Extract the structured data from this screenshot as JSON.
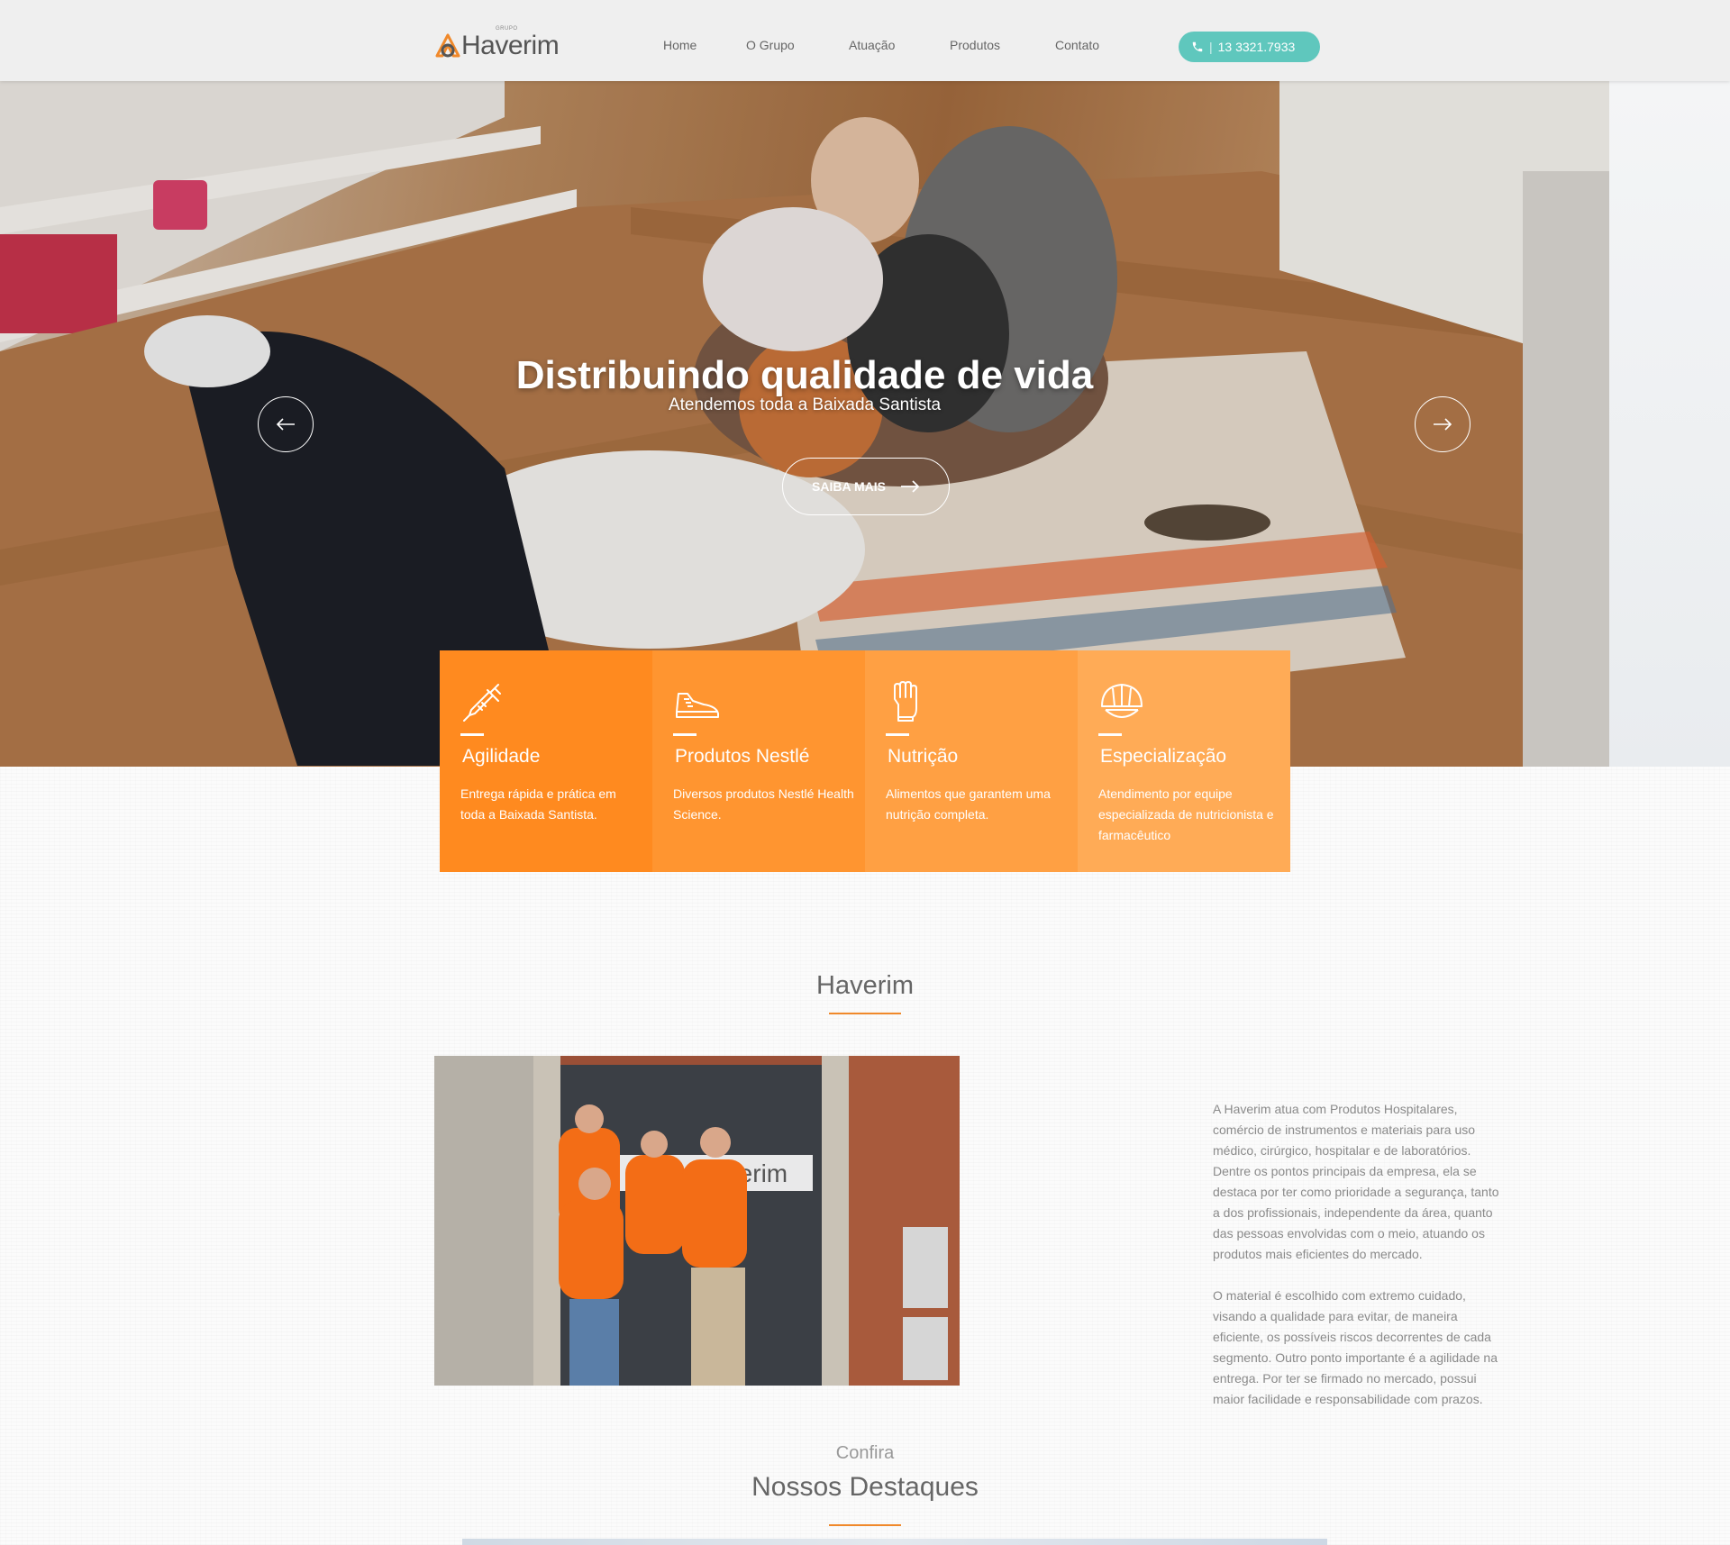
{
  "header": {
    "logo_small": "GRUPO",
    "logo_word": "Haverim",
    "nav": [
      "Home",
      "O Grupo",
      "Atuação",
      "Produtos",
      "Contato"
    ],
    "phone": "13 3321.7933",
    "phone_bg": "#5fc7bd"
  },
  "hero": {
    "title": "Distribuindo qualidade de vida",
    "subtitle": "Atendemos toda a Baixada Santista",
    "button": "SAIBA MAIS"
  },
  "features": [
    {
      "icon": "syringe-icon",
      "title": "Agilidade",
      "text": "Entrega rápida e prática em toda a Baixada Santista.",
      "color": "#ff8a1f"
    },
    {
      "icon": "shoe-icon",
      "title": "Produtos Nestlé",
      "text": "Diversos produtos Nestlé Health Science.",
      "color": "#ff9530"
    },
    {
      "icon": "glove-icon",
      "title": "Nutrição",
      "text": "Alimentos que garantem uma nutrição completa.",
      "color": "#ffa043"
    },
    {
      "icon": "helmet-icon",
      "title": "Especialização",
      "text": "Atendimento por equipe especializada de nutricionista e farmacêutico",
      "color": "#ffab56"
    }
  ],
  "about": {
    "title": "Haverim",
    "paragraph1": "A Haverim atua com Produtos Hospitalares, comércio de instrumentos e materiais para uso médico, cirúrgico, hospitalar e de laboratórios. Dentre os pontos principais da empresa, ela se destaca por ter como prioridade a segurança, tanto a dos profissionais, independente da área, quanto das pessoas envolvidas com o meio, atuando os produtos mais eficientes do mercado.",
    "paragraph2": "O material é escolhido com extremo cuidado, visando a qualidade para evitar, de maneira eficiente, os possíveis riscos decorrentes de cada segmento. Outro ponto importante é a agilidade na entrega. Por ter se firmado no mercado, possui maior facilidade e responsabilidade com prazos.",
    "sign_text": "Haverim"
  },
  "highlights": {
    "kicker": "Confira",
    "title": "Nossos Destaques"
  },
  "colors": {
    "accent": "#f0892b"
  }
}
